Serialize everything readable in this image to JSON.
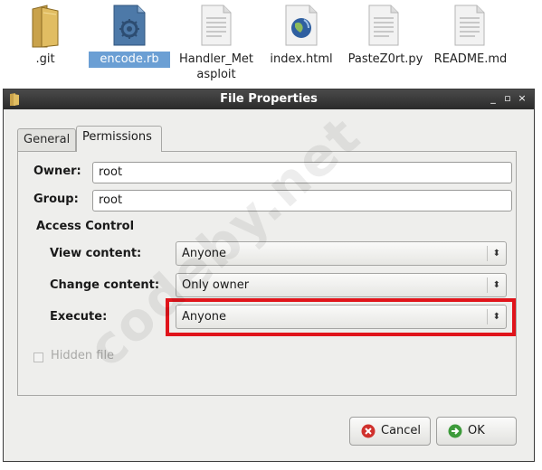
{
  "desktop": {
    "files": [
      {
        "name": ".git",
        "icon": "folder-icon"
      },
      {
        "name": "encode.rb",
        "icon": "ruby-file-icon",
        "selected": true
      },
      {
        "name": "Handler_Met\nasploit",
        "icon": "text-file-icon"
      },
      {
        "name": "index.html",
        "icon": "html-file-icon"
      },
      {
        "name": "PasteZ0rt.py",
        "icon": "text-file-icon"
      },
      {
        "name": "README.md",
        "icon": "text-file-icon"
      }
    ]
  },
  "window": {
    "title": "File Properties",
    "buttons": {
      "minimize": "_",
      "maximize": "▫",
      "close": "×"
    }
  },
  "tabs": [
    {
      "label": "General",
      "active": false
    },
    {
      "label": "Permissions",
      "active": true
    }
  ],
  "permissions": {
    "owner_label": "Owner:",
    "owner_value": "root",
    "group_label": "Group:",
    "group_value": "root",
    "access_control_heading": "Access Control",
    "view_content_label": "View content:",
    "view_content_value": "Anyone",
    "change_content_label": "Change content:",
    "change_content_value": "Only owner",
    "execute_label": "Execute:",
    "execute_value": "Anyone",
    "hidden_file_label": "Hidden file",
    "hidden_file_checked": false
  },
  "actions": {
    "cancel_label": "Cancel",
    "ok_label": "OK"
  },
  "watermark": "codeby.net",
  "colors": {
    "highlight": "#e0141b",
    "selection": "#6b9fd4",
    "titlebar": "#2b2b2b"
  }
}
